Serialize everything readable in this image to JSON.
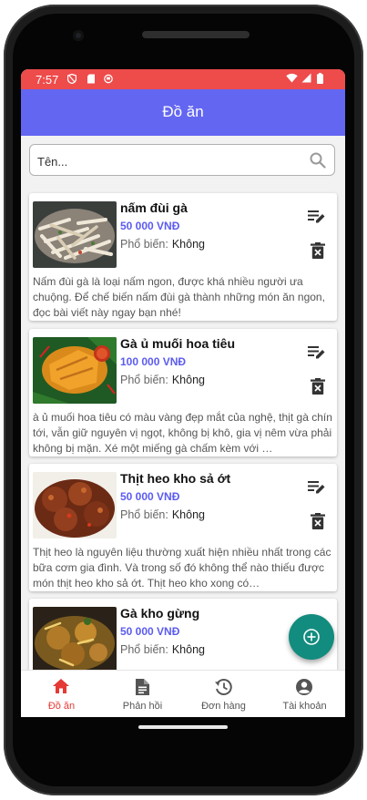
{
  "status_bar": {
    "time": "7:57"
  },
  "app_bar": {
    "title": "Đồ ăn"
  },
  "search": {
    "placeholder": "Tên..."
  },
  "popular_label": "Phổ biến:",
  "foods": [
    {
      "name": "nấm đùi gà",
      "price": "50 000 VNĐ",
      "popular": "Không",
      "description": "Nấm đùi gà là loại nấm ngon, được khá nhiều người ưa chuộng. Để chế biến nấm đùi gà thành những món ăn ngon, đọc bài viết này ngay bạn nhé!"
    },
    {
      "name": "Gà ủ muối hoa tiêu",
      "price": "100 000 VNĐ",
      "popular": "Không",
      "description": "à ủ muối hoa tiêu có màu vàng đẹp mắt của nghệ, thịt gà chín tới, vẫn giữ nguyên vị ngọt, không bị khô, gia vị nêm vừa phải không bị mặn. Xé một miếng gà chấm kèm với …"
    },
    {
      "name": "Thịt heo kho sả ớt",
      "price": "50 000 VNĐ",
      "popular": "Không",
      "description": "Thịt heo là nguyên liệu thường xuất hiện nhiều nhất trong các bữa cơm gia đình. Và trong số đó không thể nào thiếu được món thịt heo kho sả ớt. Thịt heo kho xong có…"
    },
    {
      "name": "Gà kho gừng",
      "price": "50 000 VNĐ",
      "popular": "Không",
      "description": ""
    }
  ],
  "bottom_nav": [
    {
      "label": "Đồ ăn",
      "icon": "home-icon",
      "active": true
    },
    {
      "label": "Phản hồi",
      "icon": "feedback-icon",
      "active": false
    },
    {
      "label": "Đơn hàng",
      "icon": "history-icon",
      "active": false
    },
    {
      "label": "Tài khoản",
      "icon": "account-icon",
      "active": false
    }
  ],
  "colors": {
    "status_bar": "#ee4b4b",
    "app_bar": "#6366f1",
    "price": "#5b5bf0",
    "fab": "#128c7e",
    "nav_active": "#e53935"
  }
}
